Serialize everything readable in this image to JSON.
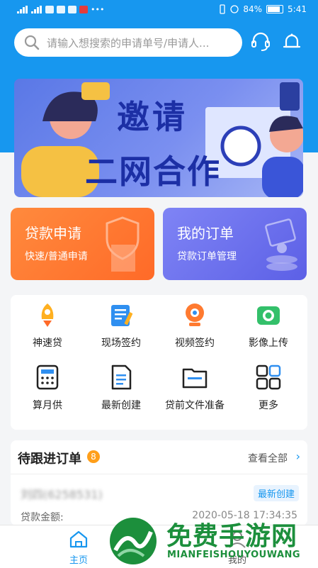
{
  "status": {
    "battery": "84%",
    "time": "5:41"
  },
  "search": {
    "placeholder": "请输入想搜索的申请单号/申请人..."
  },
  "banner": {
    "line1": "邀请",
    "line2": "二网合作"
  },
  "cards": [
    {
      "title": "贷款申请",
      "sub": "快速/普通申请"
    },
    {
      "title": "我的订单",
      "sub": "贷款订单管理"
    }
  ],
  "grid": [
    {
      "label": "神速贷",
      "icon": "rocket-icon"
    },
    {
      "label": "现场签约",
      "icon": "clipboard-icon"
    },
    {
      "label": "视频签约",
      "icon": "webcam-icon"
    },
    {
      "label": "影像上传",
      "icon": "camera-icon"
    },
    {
      "label": "算月供",
      "icon": "calculator-icon"
    },
    {
      "label": "最新创建",
      "icon": "document-icon"
    },
    {
      "label": "贷前文件准备",
      "icon": "folder-icon"
    },
    {
      "label": "更多",
      "icon": "grid-icon"
    }
  ],
  "orders": {
    "title": "待跟进订单",
    "badge": "8",
    "view_all": "查看全部",
    "item": {
      "name": "刘四(6258531)",
      "tag": "最新创建",
      "amount_label": "贷款金额:",
      "time": "2020-05-18 17:34:35"
    }
  },
  "tabs": [
    {
      "label": "主页",
      "active": true
    },
    {
      "label": "我的",
      "active": false
    }
  ],
  "watermark": {
    "title": "免费手游网",
    "sub": "MIANFEISHOUYOUWANG"
  },
  "colors": {
    "primary": "#1797ef",
    "orange": "#ff7a30",
    "purple": "#6a6ef0"
  }
}
